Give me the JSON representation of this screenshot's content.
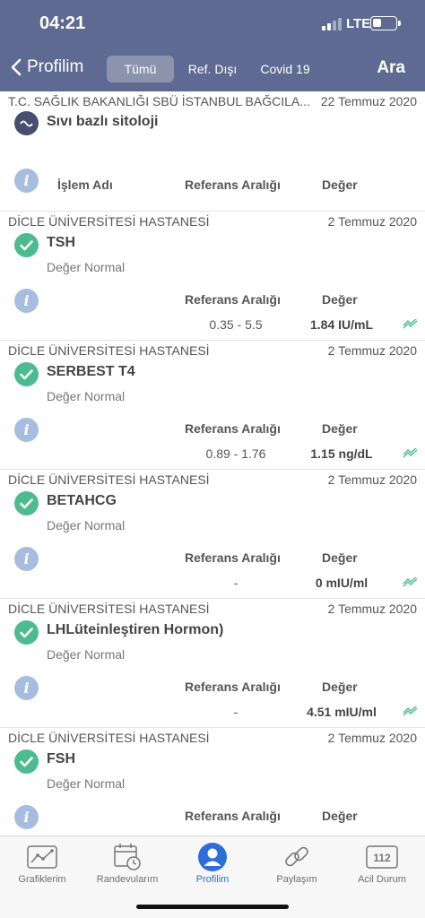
{
  "status_bar": {
    "time": "04:21",
    "network": "LTE"
  },
  "nav": {
    "back_label": "Profilim",
    "segments": [
      "Tümü",
      "Ref. Dışı",
      "Covid 19"
    ],
    "active_segment": "Tümü",
    "search_label": "Ara"
  },
  "columns": {
    "name": "İşlem Adı",
    "range": "Referans Aralığı",
    "value": "Değer"
  },
  "results": [
    {
      "hospital": "T.C. SAĞLIK BAKANLIĞI SBÜ İSTANBUL BAĞCILA...",
      "date": "22 Temmuz 2020",
      "test": "Sıvı bazlı sitoloji",
      "note": "",
      "range": "",
      "value": "",
      "status": "pending"
    },
    {
      "hospital": "DİCLE ÜNİVERSİTESİ HASTANESİ",
      "date": "2 Temmuz 2020",
      "test": "TSH",
      "note": "Değer Normal",
      "range": "0.35 - 5.5",
      "value": "1.84 IU/mL",
      "status": "normal"
    },
    {
      "hospital": "DİCLE ÜNİVERSİTESİ HASTANESİ",
      "date": "2 Temmuz 2020",
      "test": "SERBEST T4",
      "note": "Değer Normal",
      "range": "0.89 - 1.76",
      "value": "1.15 ng/dL",
      "status": "normal"
    },
    {
      "hospital": "DİCLE ÜNİVERSİTESİ HASTANESİ",
      "date": "2 Temmuz 2020",
      "test": "BETAHCG",
      "note": "Değer Normal",
      "range": "-",
      "value": "0 mIU/ml",
      "status": "normal"
    },
    {
      "hospital": "DİCLE ÜNİVERSİTESİ HASTANESİ",
      "date": "2 Temmuz 2020",
      "test": "LHLüteinleştiren Hormon)",
      "note": "Değer Normal",
      "range": "-",
      "value": "4.51 mIU/ml",
      "status": "normal"
    },
    {
      "hospital": "DİCLE ÜNİVERSİTESİ HASTANESİ",
      "date": "2 Temmuz 2020",
      "test": "FSH",
      "note": "Değer Normal",
      "range": "",
      "value": "",
      "status": "normal"
    }
  ],
  "tabbar": {
    "tabs": [
      "Grafiklerim",
      "Randevularım",
      "Profilim",
      "Paylaşım",
      "Acil Durum"
    ],
    "active": "Profilim",
    "emergency_number": "112"
  },
  "colors": {
    "header": "#5e6a92",
    "ok": "#4cbb8f",
    "info": "#a7bde0",
    "active_tab": "#2d6ed8"
  }
}
